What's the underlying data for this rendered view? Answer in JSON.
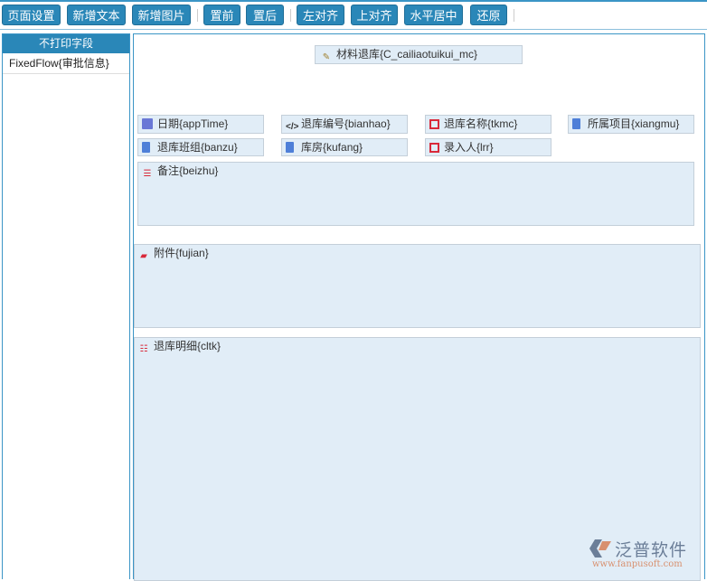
{
  "toolbar": {
    "buttons": [
      "页面设置",
      "新增文本",
      "新增图片",
      "置前",
      "置后",
      "左对齐",
      "上对齐",
      "水平居中",
      "还原"
    ]
  },
  "left_panel": {
    "header": "不打印字段",
    "items": [
      "FixedFlow{审批信息}"
    ]
  },
  "canvas": {
    "title_field": "材料退库{C_cailiaotuikui_mc}",
    "fields": [
      "日期{appTime}",
      "退库编号{bianhao}",
      "退库名称{tkmc}",
      "所属项目{xiangmu}",
      "退库班组{banzu}",
      "库房{kufang}",
      "录入人{lrr}"
    ],
    "remark": "备注{beizhu}",
    "attachment": "附件{fujian}",
    "detail": "退库明细{cltk}"
  },
  "logo": {
    "name": "泛普软件",
    "url": "www.fanpusoft.com"
  }
}
